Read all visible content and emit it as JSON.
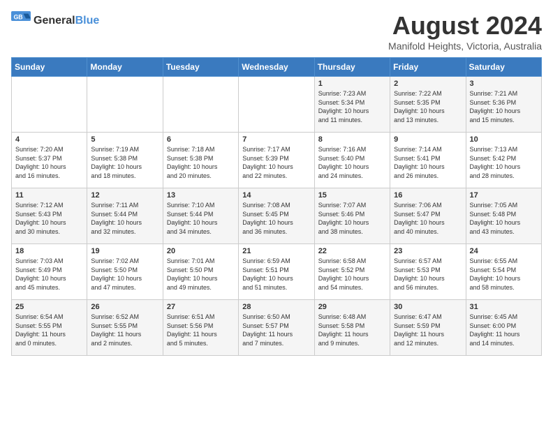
{
  "header": {
    "logo_general": "General",
    "logo_blue": "Blue",
    "title": "August 2024",
    "subtitle": "Manifold Heights, Victoria, Australia"
  },
  "days_of_week": [
    "Sunday",
    "Monday",
    "Tuesday",
    "Wednesday",
    "Thursday",
    "Friday",
    "Saturday"
  ],
  "weeks": [
    [
      {
        "day": "",
        "info": ""
      },
      {
        "day": "",
        "info": ""
      },
      {
        "day": "",
        "info": ""
      },
      {
        "day": "",
        "info": ""
      },
      {
        "day": "1",
        "info": "Sunrise: 7:23 AM\nSunset: 5:34 PM\nDaylight: 10 hours\nand 11 minutes."
      },
      {
        "day": "2",
        "info": "Sunrise: 7:22 AM\nSunset: 5:35 PM\nDaylight: 10 hours\nand 13 minutes."
      },
      {
        "day": "3",
        "info": "Sunrise: 7:21 AM\nSunset: 5:36 PM\nDaylight: 10 hours\nand 15 minutes."
      }
    ],
    [
      {
        "day": "4",
        "info": "Sunrise: 7:20 AM\nSunset: 5:37 PM\nDaylight: 10 hours\nand 16 minutes."
      },
      {
        "day": "5",
        "info": "Sunrise: 7:19 AM\nSunset: 5:38 PM\nDaylight: 10 hours\nand 18 minutes."
      },
      {
        "day": "6",
        "info": "Sunrise: 7:18 AM\nSunset: 5:38 PM\nDaylight: 10 hours\nand 20 minutes."
      },
      {
        "day": "7",
        "info": "Sunrise: 7:17 AM\nSunset: 5:39 PM\nDaylight: 10 hours\nand 22 minutes."
      },
      {
        "day": "8",
        "info": "Sunrise: 7:16 AM\nSunset: 5:40 PM\nDaylight: 10 hours\nand 24 minutes."
      },
      {
        "day": "9",
        "info": "Sunrise: 7:14 AM\nSunset: 5:41 PM\nDaylight: 10 hours\nand 26 minutes."
      },
      {
        "day": "10",
        "info": "Sunrise: 7:13 AM\nSunset: 5:42 PM\nDaylight: 10 hours\nand 28 minutes."
      }
    ],
    [
      {
        "day": "11",
        "info": "Sunrise: 7:12 AM\nSunset: 5:43 PM\nDaylight: 10 hours\nand 30 minutes."
      },
      {
        "day": "12",
        "info": "Sunrise: 7:11 AM\nSunset: 5:44 PM\nDaylight: 10 hours\nand 32 minutes."
      },
      {
        "day": "13",
        "info": "Sunrise: 7:10 AM\nSunset: 5:44 PM\nDaylight: 10 hours\nand 34 minutes."
      },
      {
        "day": "14",
        "info": "Sunrise: 7:08 AM\nSunset: 5:45 PM\nDaylight: 10 hours\nand 36 minutes."
      },
      {
        "day": "15",
        "info": "Sunrise: 7:07 AM\nSunset: 5:46 PM\nDaylight: 10 hours\nand 38 minutes."
      },
      {
        "day": "16",
        "info": "Sunrise: 7:06 AM\nSunset: 5:47 PM\nDaylight: 10 hours\nand 40 minutes."
      },
      {
        "day": "17",
        "info": "Sunrise: 7:05 AM\nSunset: 5:48 PM\nDaylight: 10 hours\nand 43 minutes."
      }
    ],
    [
      {
        "day": "18",
        "info": "Sunrise: 7:03 AM\nSunset: 5:49 PM\nDaylight: 10 hours\nand 45 minutes."
      },
      {
        "day": "19",
        "info": "Sunrise: 7:02 AM\nSunset: 5:50 PM\nDaylight: 10 hours\nand 47 minutes."
      },
      {
        "day": "20",
        "info": "Sunrise: 7:01 AM\nSunset: 5:50 PM\nDaylight: 10 hours\nand 49 minutes."
      },
      {
        "day": "21",
        "info": "Sunrise: 6:59 AM\nSunset: 5:51 PM\nDaylight: 10 hours\nand 51 minutes."
      },
      {
        "day": "22",
        "info": "Sunrise: 6:58 AM\nSunset: 5:52 PM\nDaylight: 10 hours\nand 54 minutes."
      },
      {
        "day": "23",
        "info": "Sunrise: 6:57 AM\nSunset: 5:53 PM\nDaylight: 10 hours\nand 56 minutes."
      },
      {
        "day": "24",
        "info": "Sunrise: 6:55 AM\nSunset: 5:54 PM\nDaylight: 10 hours\nand 58 minutes."
      }
    ],
    [
      {
        "day": "25",
        "info": "Sunrise: 6:54 AM\nSunset: 5:55 PM\nDaylight: 11 hours\nand 0 minutes."
      },
      {
        "day": "26",
        "info": "Sunrise: 6:52 AM\nSunset: 5:55 PM\nDaylight: 11 hours\nand 2 minutes."
      },
      {
        "day": "27",
        "info": "Sunrise: 6:51 AM\nSunset: 5:56 PM\nDaylight: 11 hours\nand 5 minutes."
      },
      {
        "day": "28",
        "info": "Sunrise: 6:50 AM\nSunset: 5:57 PM\nDaylight: 11 hours\nand 7 minutes."
      },
      {
        "day": "29",
        "info": "Sunrise: 6:48 AM\nSunset: 5:58 PM\nDaylight: 11 hours\nand 9 minutes."
      },
      {
        "day": "30",
        "info": "Sunrise: 6:47 AM\nSunset: 5:59 PM\nDaylight: 11 hours\nand 12 minutes."
      },
      {
        "day": "31",
        "info": "Sunrise: 6:45 AM\nSunset: 6:00 PM\nDaylight: 11 hours\nand 14 minutes."
      }
    ]
  ]
}
